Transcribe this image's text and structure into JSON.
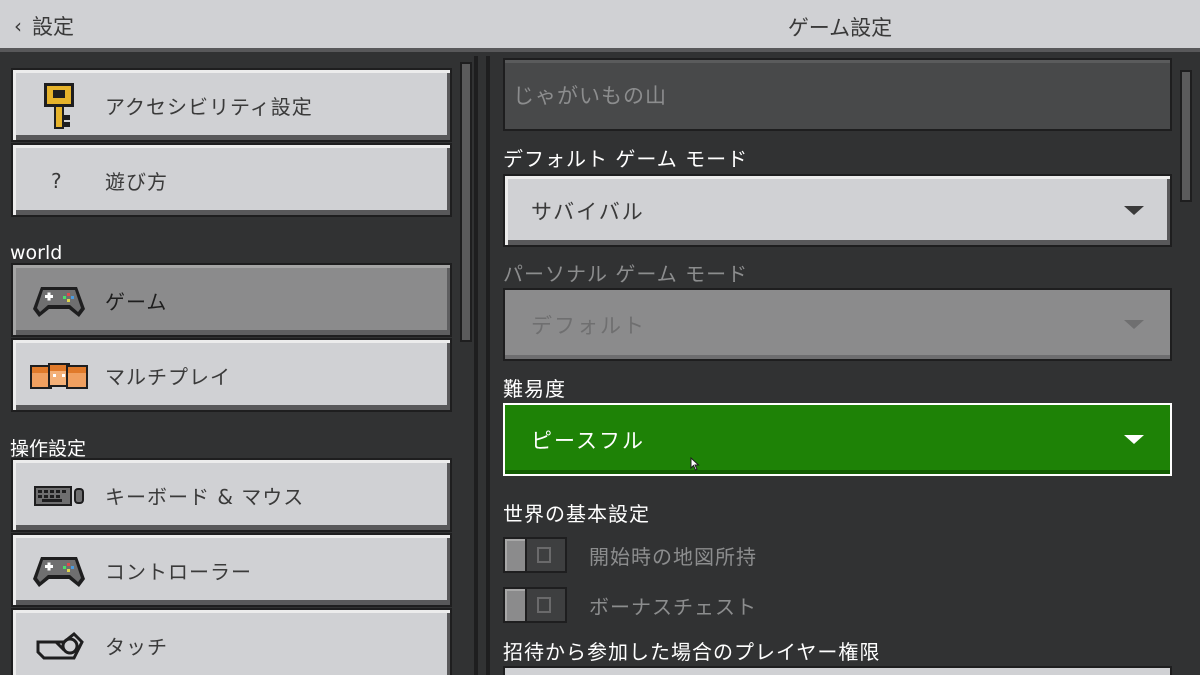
{
  "header": {
    "back_label": "設定",
    "title": "ゲーム設定"
  },
  "sidebar": {
    "items_top": [
      {
        "label": "アクセシビリティ設定",
        "icon": "key-icon"
      },
      {
        "label": "遊び方",
        "icon": "question-icon"
      }
    ],
    "sections": [
      {
        "title": "world",
        "items": [
          {
            "label": "ゲーム",
            "icon": "controller-icon",
            "selected": true
          },
          {
            "label": "マルチプレイ",
            "icon": "players-icon"
          }
        ]
      },
      {
        "title": "操作設定",
        "items": [
          {
            "label": "キーボード & マウス",
            "icon": "keyboard-icon"
          },
          {
            "label": "コントローラー",
            "icon": "controller-icon"
          },
          {
            "label": "タッチ",
            "icon": "touch-icon"
          }
        ]
      }
    ]
  },
  "main": {
    "world_name": "じゃがいもの山",
    "default_mode_label": "デフォルト ゲーム モード",
    "default_mode_value": "サバイバル",
    "personal_mode_label": "パーソナル ゲーム モード",
    "personal_mode_value": "デフォルト",
    "difficulty_label": "難易度",
    "difficulty_value": "ピースフル",
    "world_prefs_label": "世界の基本設定",
    "toggles": [
      {
        "label": "開始時の地図所持",
        "on": false
      },
      {
        "label": "ボーナスチェスト",
        "on": false
      }
    ],
    "invite_perm_label": "招待から参加した場合のプレイヤー権限"
  },
  "colors": {
    "accent_green": "#1e8206",
    "panel_bg": "#313233",
    "button_light": "#d0d1d4"
  }
}
